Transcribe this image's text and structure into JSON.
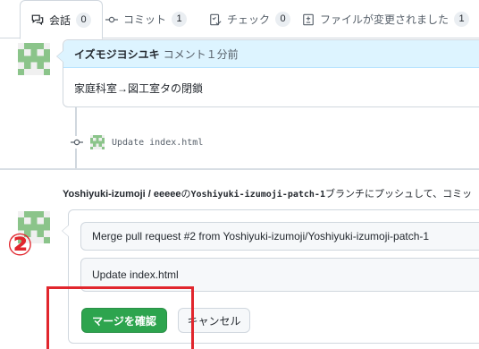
{
  "tabs": [
    {
      "label": "会話",
      "count": "0",
      "icon": "conversation-icon"
    },
    {
      "label": "コミット",
      "count": "1",
      "icon": "commit-icon"
    },
    {
      "label": "チェック",
      "count": "0",
      "icon": "checklist-icon"
    },
    {
      "label": "ファイルが変更されました",
      "count": "1",
      "icon": "file-diff-icon"
    }
  ],
  "comment": {
    "author": "イズモジヨシユキ",
    "meta": "コメント１分前",
    "body": "家庭科室→図工室タの閉鎖"
  },
  "commit": {
    "message": "Update index.html"
  },
  "merge": {
    "repo": "Yoshiyuki-izumoji / eeeee",
    "no": "の",
    "branch": "Yoshiyuki-izumoji-patch-1",
    "rest": "ブランチにプッシュして、コミッ",
    "title_value": "Merge pull request #2 from Yoshiyuki-izumoji/Yoshiyuki-izumoji-patch-1",
    "body_value": "Update index.html",
    "confirm_label": "マージを確認",
    "cancel_label": "キャンセル"
  },
  "annotation": {
    "number": "②"
  },
  "colors": {
    "primary_button": "#2da44e",
    "comment_header": "#ddf4ff",
    "annotation_red": "#e1262d",
    "avatar_green": "#8bc48a"
  }
}
